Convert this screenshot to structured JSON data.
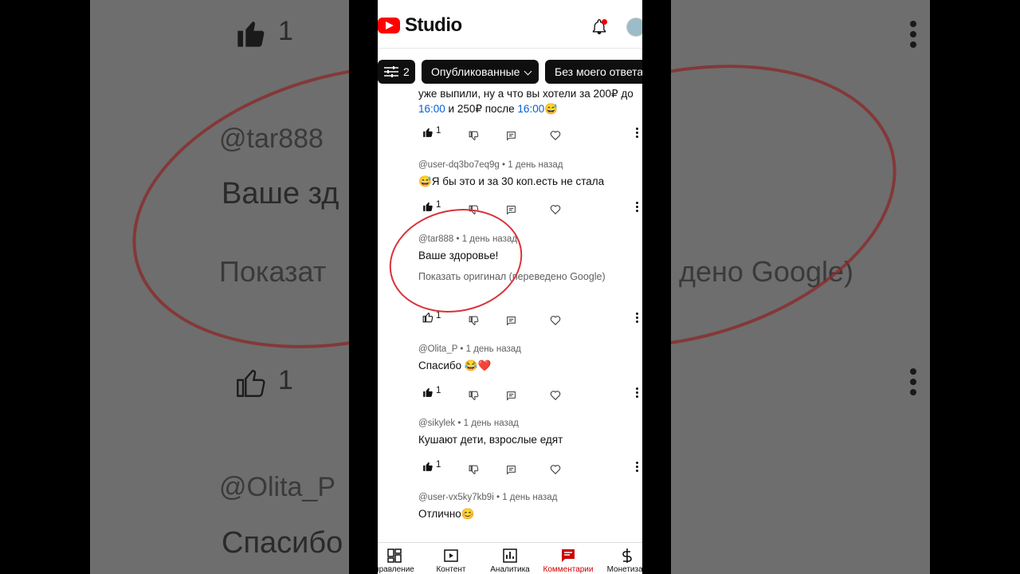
{
  "app": {
    "title": "Studio"
  },
  "filters": {
    "filter_count": "2",
    "published": "Опубликованные",
    "no_reply": "Без моего ответа"
  },
  "comments": [
    {
      "text_a": "уже выпили, ну а что вы хотели за 200₽ до ",
      "time_1": "16:00",
      "text_b": " и 250₽ после ",
      "time_2": "16:00",
      "emoji": "😅",
      "likes": "1"
    },
    {
      "author": "@user-dq3bo7eq9g",
      "time": "1 день назад",
      "text": "😅Я бы это и за 30 коп.есть не стала",
      "likes": "1"
    },
    {
      "author": "@tar888",
      "time": "1 день назад",
      "text": "Ваше здоровье!",
      "translate": "Показать оригинал (переведено Google)",
      "likes": "1"
    },
    {
      "author": "@Olita_P",
      "time": "1 день назад",
      "text": "Спасибо 😂❤️",
      "likes": "1"
    },
    {
      "author": "@sikylek",
      "time": "1 день назад",
      "text": "Кушают дети, взрослые едят",
      "likes": "1"
    },
    {
      "author": "@user-vx5ky7kb9i",
      "time": "1 день назад",
      "text": "Отлично😊"
    }
  ],
  "nav": [
    {
      "label": "правление"
    },
    {
      "label": "Контент"
    },
    {
      "label": "Аналитика"
    },
    {
      "label": "Комментарии"
    },
    {
      "label": "Монетизац"
    }
  ],
  "bg": {
    "left_author": "@tar888",
    "left_text": "Ваше зд",
    "left_translate": "Показат",
    "left_likes": "1",
    "left_author2": "@Olita_P",
    "left_text2": "Спасибо",
    "right_translate": "дено Google)"
  },
  "colors": {
    "accent": "#ff0000",
    "active_nav": "#cc0000",
    "link": "#065fd4",
    "annotation": "#d9323a"
  }
}
